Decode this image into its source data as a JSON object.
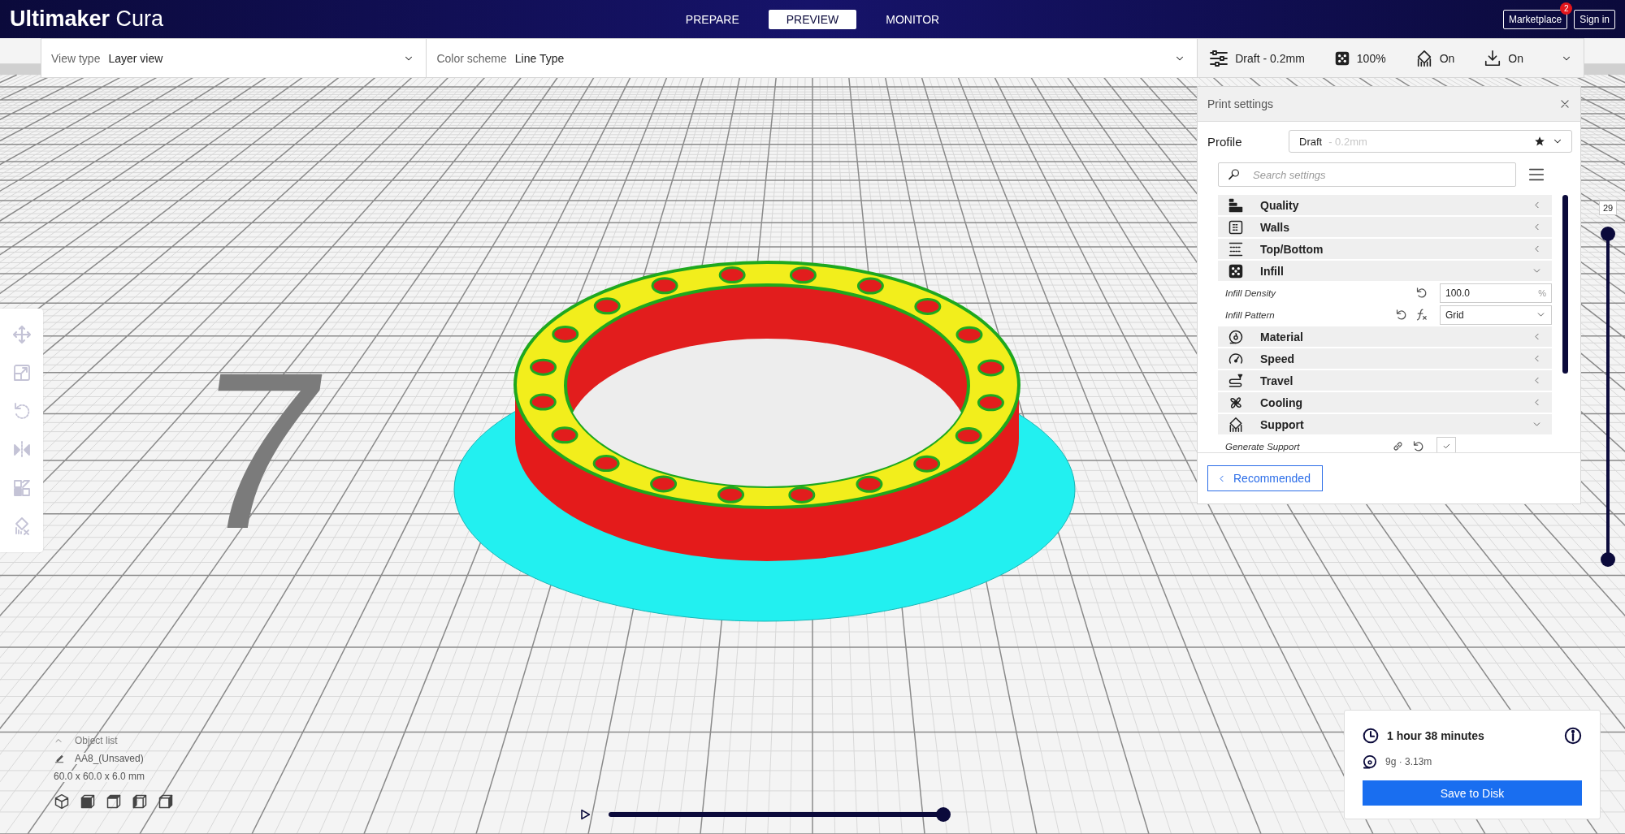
{
  "app": {
    "logo": "**Ultimaker** Cura"
  },
  "stages": [
    {
      "label": "PREPARE",
      "selected": false
    },
    {
      "label": "PREVIEW",
      "selected": true
    },
    {
      "label": "MONITOR",
      "selected": false
    }
  ],
  "header_buttons": [
    {
      "label": "Marketplace",
      "badge": "2"
    },
    {
      "label": "Sign in"
    }
  ],
  "toolbar": {
    "view_type": {
      "label": "View type",
      "value": "Layer view"
    },
    "color_scheme": {
      "label": "Color scheme",
      "value": "Line Type"
    },
    "print_setup": {
      "profile": "Draft - 0.2mm",
      "infill": "100%",
      "support": "On",
      "adhesion": "On"
    }
  },
  "tools": [
    {
      "kind": "move",
      "disabled": true
    },
    {
      "kind": "scale",
      "disabled": true
    },
    {
      "kind": "rotate",
      "disabled": true
    },
    {
      "kind": "mirror",
      "disabled": true
    },
    {
      "kind": "per_model",
      "disabled": true
    },
    {
      "kind": "support_blocker",
      "disabled": true
    }
  ],
  "scene_label": "7",
  "print_settings": {
    "title": "Print settings",
    "profile_label": "Profile",
    "profile_name": "Draft",
    "profile_suffix": " - 0.2mm",
    "search_placeholder": "Search settings",
    "categories": [
      {
        "kind": "quality",
        "label": "Quality",
        "expanded": false
      },
      {
        "kind": "walls",
        "label": "Walls",
        "expanded": false
      },
      {
        "kind": "topbottom",
        "label": "Top/Bottom",
        "expanded": false
      },
      {
        "kind": "infill",
        "label": "Infill",
        "expanded": true,
        "settings": [
          {
            "kind": "number",
            "label": "Infill Density",
            "actions": [
              {
                "kind": "reset"
              }
            ],
            "value": "100.0",
            "unit": "%"
          },
          {
            "kind": "select",
            "label": "Infill Pattern",
            "actions": [
              {
                "kind": "reset"
              },
              {
                "kind": "function"
              }
            ],
            "value": "Grid"
          }
        ]
      },
      {
        "kind": "material",
        "label": "Material",
        "expanded": false
      },
      {
        "kind": "speed",
        "label": "Speed",
        "expanded": false
      },
      {
        "kind": "travel",
        "label": "Travel",
        "expanded": false
      },
      {
        "kind": "cooling",
        "label": "Cooling",
        "expanded": false
      },
      {
        "kind": "support",
        "label": "Support",
        "expanded": true,
        "settings": [
          {
            "kind": "checkbox",
            "label": "Generate Support",
            "actions": [
              {
                "kind": "link"
              },
              {
                "kind": "reset"
              }
            ],
            "checked": true
          }
        ]
      }
    ],
    "recommended_button": "Recommended"
  },
  "layer_slider": {
    "value": "29",
    "level": 1
  },
  "object_list": {
    "title": "Object list",
    "object_name": "AA8_(Unsaved)",
    "dimensions": "60.0 x 60.0 x 6.0 mm",
    "views": [
      {
        "kind": "perspective"
      },
      {
        "kind": "front"
      },
      {
        "kind": "top"
      },
      {
        "kind": "left"
      },
      {
        "kind": "right"
      }
    ]
  },
  "playback": {
    "level": 1
  },
  "print_info": {
    "time": "1 hour 38 minutes",
    "material": "9g · 3.13m",
    "button": "Save to Disk"
  }
}
